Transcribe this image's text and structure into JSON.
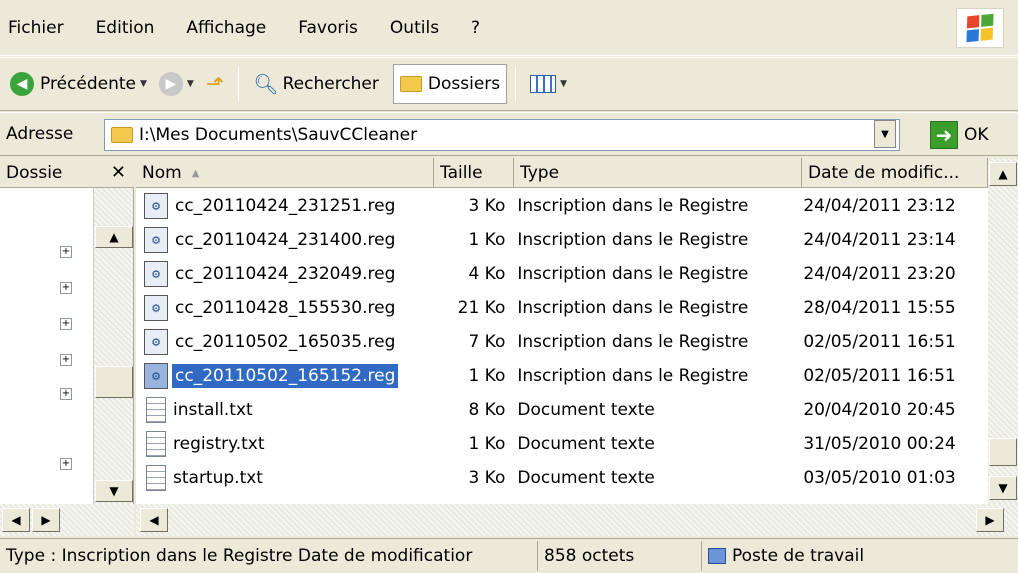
{
  "menubar": {
    "items": [
      "Fichier",
      "Edition",
      "Affichage",
      "Favoris",
      "Outils",
      "?"
    ]
  },
  "toolbar": {
    "back_label": "Précédente",
    "search_label": "Rechercher",
    "folders_label": "Dossiers"
  },
  "address": {
    "label": "Adresse",
    "value": "I:\\Mes Documents\\SauvCCleaner",
    "go_label": "OK"
  },
  "folder_pane": {
    "title": "Dossie",
    "close_glyph": "✕"
  },
  "columns": [
    "Nom",
    "Taille",
    "Type",
    "Date de modific..."
  ],
  "files": [
    {
      "name": "cc_20110424_231251.reg",
      "size": "3 Ko",
      "type": "Inscription dans le Registre",
      "date": "24/04/2011 23:12",
      "icon": "registry-file-icon",
      "selected": false
    },
    {
      "name": "cc_20110424_231400.reg",
      "size": "1 Ko",
      "type": "Inscription dans le Registre",
      "date": "24/04/2011 23:14",
      "icon": "registry-file-icon",
      "selected": false
    },
    {
      "name": "cc_20110424_232049.reg",
      "size": "4 Ko",
      "type": "Inscription dans le Registre",
      "date": "24/04/2011 23:20",
      "icon": "registry-file-icon",
      "selected": false
    },
    {
      "name": "cc_20110428_155530.reg",
      "size": "21 Ko",
      "type": "Inscription dans le Registre",
      "date": "28/04/2011 15:55",
      "icon": "registry-file-icon",
      "selected": false
    },
    {
      "name": "cc_20110502_165035.reg",
      "size": "7 Ko",
      "type": "Inscription dans le Registre",
      "date": "02/05/2011 16:51",
      "icon": "registry-file-icon",
      "selected": false
    },
    {
      "name": "cc_20110502_165152.reg",
      "size": "1 Ko",
      "type": "Inscription dans le Registre",
      "date": "02/05/2011 16:51",
      "icon": "registry-file-icon",
      "selected": true
    },
    {
      "name": "install.txt",
      "size": "8 Ko",
      "type": "Document texte",
      "date": "20/04/2010 20:45",
      "icon": "text-file-icon",
      "selected": false
    },
    {
      "name": "registry.txt",
      "size": "1 Ko",
      "type": "Document texte",
      "date": "31/05/2010 00:24",
      "icon": "text-file-icon",
      "selected": false
    },
    {
      "name": "startup.txt",
      "size": "3 Ko",
      "type": "Document texte",
      "date": "03/05/2010 01:03",
      "icon": "text-file-icon",
      "selected": false
    }
  ],
  "status": {
    "info": "Type : Inscription dans le Registre Date de modificatior",
    "size": "858 octets",
    "location": "Poste de travail"
  },
  "colors": {
    "selection": "#316ac5",
    "chrome": "#ece9d8"
  }
}
